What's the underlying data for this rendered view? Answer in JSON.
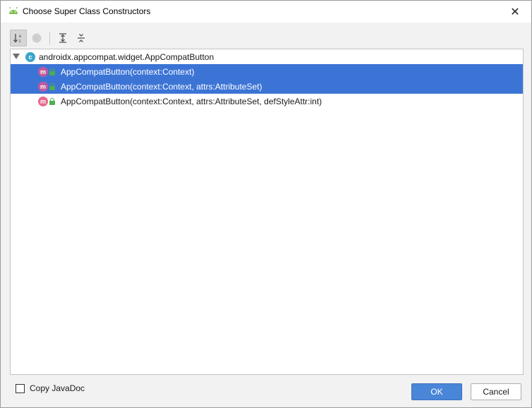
{
  "window": {
    "title": "Choose Super Class Constructors",
    "close_glyph": "✕"
  },
  "toolbar": {
    "buttons": [
      {
        "icon": "sort-alphabetically-icon",
        "active": true
      },
      {
        "icon": "show-classes-icon",
        "active": false
      },
      {
        "icon": "expand-all-icon",
        "active": false
      },
      {
        "icon": "collapse-all-icon",
        "active": false
      }
    ]
  },
  "tree": {
    "root": {
      "badge": "c",
      "label": "androidx.appcompat.widget.AppCompatButton"
    },
    "items": [
      {
        "badge": "m",
        "label": "AppCompatButton(context:Context)",
        "selected": true
      },
      {
        "badge": "m",
        "label": "AppCompatButton(context:Context, attrs:AttributeSet)",
        "selected": true
      },
      {
        "badge": "m",
        "label": "AppCompatButton(context:Context, attrs:AttributeSet, defStyleAttr:int)",
        "selected": false
      }
    ]
  },
  "footer": {
    "copy_javadoc_label": "Copy JavaDoc",
    "copy_javadoc_checked": false,
    "ok_label": "OK",
    "cancel_label": "Cancel"
  },
  "colors": {
    "selection": "#3c74d6",
    "ok_button": "#4a86d8",
    "class_badge": "#3ea5c9",
    "method_badge": "#e86a8c"
  }
}
